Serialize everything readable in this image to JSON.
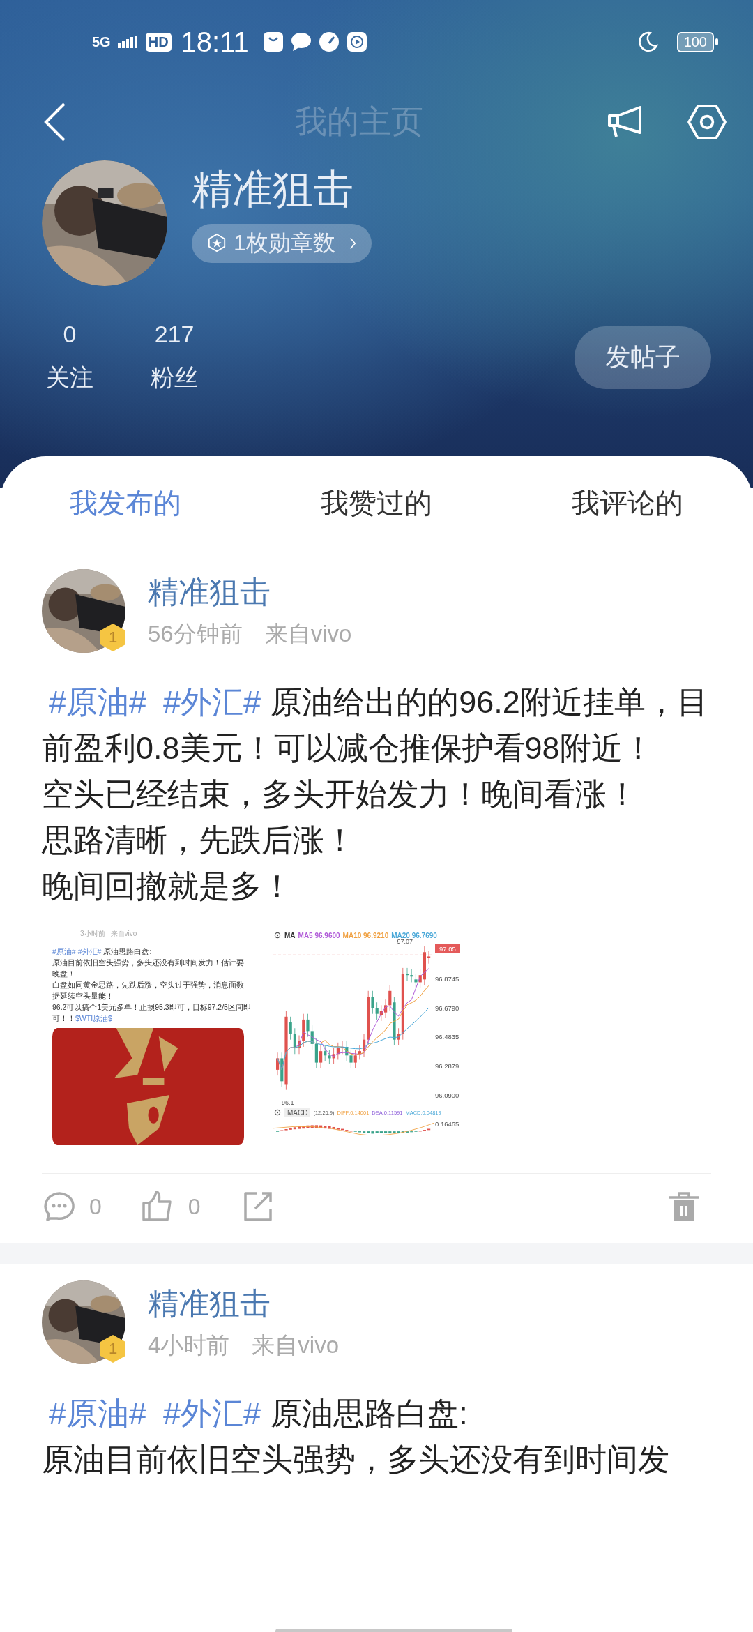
{
  "status_bar": {
    "network": "5G",
    "hd": "HD",
    "time": "18:11",
    "battery": "100"
  },
  "nav": {
    "title": "我的主页"
  },
  "profile": {
    "name": "精准狙击",
    "medals": "1枚勋章数",
    "stats": [
      {
        "value": "0",
        "label": "关注"
      },
      {
        "value": "217",
        "label": "粉丝"
      }
    ],
    "post_button": "发帖子"
  },
  "tabs": [
    {
      "label": "我发布的",
      "selected": true
    },
    {
      "label": "我赞过的",
      "selected": false
    },
    {
      "label": "我评论的",
      "selected": false
    }
  ],
  "posts": [
    {
      "author": "精准狙击",
      "level": "1",
      "time": "56分钟前",
      "source": "来自vivo",
      "tags": [
        "#原油#",
        "#外汇#"
      ],
      "lines": [
        "原油给出的的96.2附近挂单，目前盈利0.8美元！可以减仓推保护看98附近！",
        "空头已经结束，多头开始发力！晚间看涨！",
        "思路清晰，先跌后涨！",
        "晚间回撤就是多！"
      ],
      "attachments": [
        {
          "kind": "post_screenshot",
          "time": "3小时前",
          "source": "来自vivo",
          "tags": [
            "#原油#",
            "#外汇#"
          ],
          "lines": [
            "原油思路白盘:",
            "原油目前依旧空头强势，多头还没有到时间发力！估计要晚盘！",
            "白盘如同黄金思路，先跌后涨，空头过于强势，消息面数据延续空头量能！",
            "96.2可以搞个1美元多单！止损95.3即可，目标97.2/5区间即可！！"
          ],
          "stock_tag": "$WTI原油$"
        },
        {
          "kind": "chart_screenshot",
          "legend": [
            {
              "text": "MA",
              "color": "#333333"
            },
            {
              "text": "MA5 96.9600",
              "color": "#b05ad8"
            },
            {
              "text": "MA10 96.9210",
              "color": "#f0a040"
            },
            {
              "text": "MA20 96.7690",
              "color": "#4aa8d8"
            }
          ],
          "high_label": "97.07",
          "current_price": "97.05",
          "y_labels": [
            "96.8745",
            "96.6790",
            "96.4835",
            "96.2879",
            "96.0900"
          ],
          "low_label": "96.1",
          "macd": {
            "name": "MACD",
            "params": "(12,26,9)",
            "diff": "DIFF:0.14001",
            "dea": "DEA:0.11591",
            "macd": "MACD:0.04819",
            "value": "0.16465"
          }
        }
      ],
      "comments": "0",
      "likes": "0"
    },
    {
      "author": "精准狙击",
      "level": "1",
      "time": "4小时前",
      "source": "来自vivo",
      "tags": [
        "#原油#",
        "#外汇#"
      ],
      "lines": [
        "原油思路白盘:",
        "原油目前依旧空头强势，多头还没有到时间发"
      ]
    }
  ]
}
